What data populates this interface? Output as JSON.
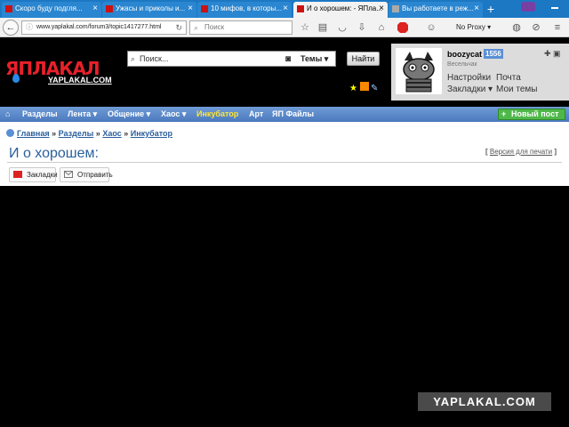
{
  "browser": {
    "tabs": [
      {
        "label": "Скоро буду подгля...",
        "active": false
      },
      {
        "label": "Ужасы и приколы и...",
        "active": false
      },
      {
        "label": "10 мифов, в которы...",
        "active": false
      },
      {
        "label": "И о хорошем: - ЯПла...",
        "active": true
      },
      {
        "label": "Вы работаете в реж...",
        "active": false
      }
    ],
    "new_tab": "+",
    "url": "www.yaplakal.com/forum3/topic1417277.html",
    "search_placeholder": "Поиск",
    "proxy_label": "No Proxy",
    "proxy_arrow": "▾"
  },
  "site": {
    "logo_text": "ЯПЛАКАЛ",
    "logo_sub": "YAPLAKAL.COM",
    "search_placeholder": "Поиск...",
    "themes_label": "Темы ▾",
    "find_button": "Найти"
  },
  "user": {
    "name": "boozycat",
    "count": "1556",
    "rank": "Весельчак",
    "settings": "Настройки",
    "mail": "Почта",
    "bookmarks": "Закладки ▾",
    "my_themes": "Мои темы",
    "panel_icons": "✚ ▣"
  },
  "nav": {
    "home_icon": "⌂",
    "items": [
      {
        "label": "Разделы"
      },
      {
        "label": "Лента ▾"
      },
      {
        "label": "Общение ▾"
      },
      {
        "label": "Хаос ▾"
      },
      {
        "label": "Инкубатор"
      },
      {
        "label": "Арт"
      },
      {
        "label": "ЯП Файлы"
      }
    ],
    "new_post": "Новый пост",
    "new_post_plus": "+"
  },
  "page": {
    "breadcrumb": [
      "Главная",
      "Разделы",
      "Хаос",
      "Инкубатор"
    ],
    "breadcrumb_sep": "»",
    "title": "И о хорошем:",
    "print_version": "Версия для печати",
    "print_brackets": [
      "[",
      "]"
    ],
    "bookmarks_btn": "Закладки",
    "send_btn": "Отправить"
  },
  "watermark": "YAPLAKAL.COM",
  "colors": {
    "tabstrip": "#1c78c3",
    "nav": "#4a79bd",
    "accent_yellow": "#ffe53a",
    "logo_red": "#e8202a",
    "new_post_green": "#4fb84a"
  }
}
